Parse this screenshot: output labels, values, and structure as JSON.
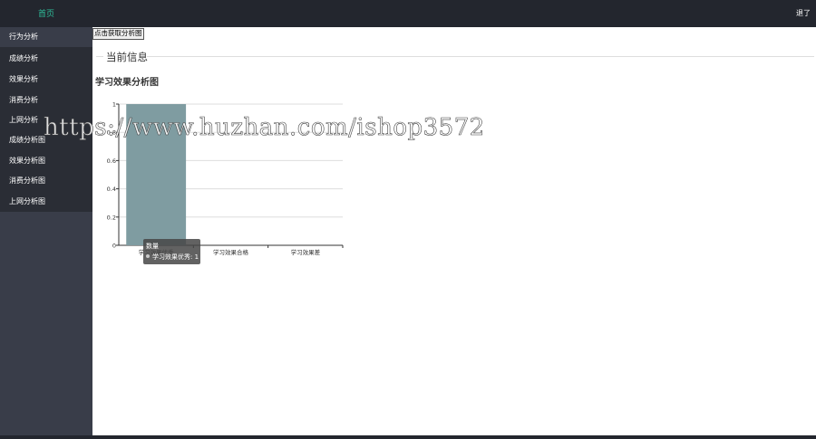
{
  "header": {
    "home_label": "首页",
    "exit_label": "退了"
  },
  "sidebar": {
    "items": [
      {
        "label": "行为分析",
        "active": true
      },
      {
        "label": "成绩分析"
      },
      {
        "label": "效果分析"
      },
      {
        "label": "消费分析"
      },
      {
        "label": "上网分析"
      },
      {
        "label": "成绩分析图"
      },
      {
        "label": "效果分析图"
      },
      {
        "label": "消费分析图"
      },
      {
        "label": "上网分析图"
      }
    ]
  },
  "main": {
    "fetch_button_label": "点击获取分析图",
    "section_label": "当前信息",
    "chart_title": "学习效果分析图"
  },
  "watermark": "https://www.huzhan.com/ishop3572",
  "tooltip": {
    "title": "数量",
    "series_value": "学习效果优秀: 1"
  },
  "colors": {
    "topbar": "#23262e",
    "sidebar": "#393d49",
    "menu": "#2a2d35",
    "accent": "#2fbf9b",
    "bar": "#7f9ca1"
  },
  "chart_data": {
    "type": "bar",
    "categories": [
      "学习效果优秀",
      "学习效果合格",
      "学习效果差"
    ],
    "series": [
      {
        "name": "数量",
        "values": [
          1,
          0,
          0
        ]
      }
    ],
    "ylim": [
      0,
      1
    ],
    "yticks": [
      "0",
      "0.2",
      "0.4",
      "0.6",
      "0.8",
      "1"
    ],
    "grid": true,
    "title": "学习效果分析图"
  }
}
